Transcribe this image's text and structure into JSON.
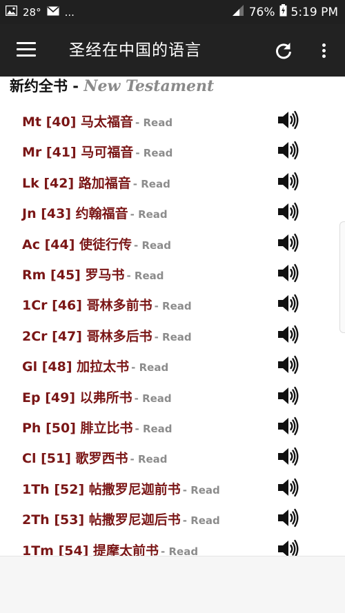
{
  "status_bar": {
    "temperature": "28°",
    "more": "...",
    "battery": "76%",
    "time": "5:19 PM"
  },
  "app_bar": {
    "title": "圣经在中国的语言"
  },
  "section": {
    "chinese": "新约全书",
    "separator": " - ",
    "english": "New Testament"
  },
  "read_label": "- Read",
  "books": [
    {
      "label": "Mt [40] 马太福音"
    },
    {
      "label": "Mr [41] 马可福音"
    },
    {
      "label": "Lk [42] 路加福音"
    },
    {
      "label": "Jn [43] 约翰福音"
    },
    {
      "label": "Ac [44] 使徒行传"
    },
    {
      "label": "Rm [45] 罗马书"
    },
    {
      "label": "1Cr [46] 哥林多前书"
    },
    {
      "label": "2Cr [47] 哥林多后书"
    },
    {
      "label": "Gl [48] 加拉太书"
    },
    {
      "label": "Ep [49] 以弗所书"
    },
    {
      "label": "Ph [50] 腓立比书"
    },
    {
      "label": "Cl [51] 歌罗西书"
    },
    {
      "label": "1Th [52] 帖撒罗尼迦前书"
    },
    {
      "label": "2Th [53] 帖撒罗尼迦后书"
    },
    {
      "label": "1Tm [54] 提摩太前书"
    }
  ],
  "colors": {
    "book_title": "#7a1616",
    "read": "#8c8c8c",
    "app_bar": "#222222"
  }
}
